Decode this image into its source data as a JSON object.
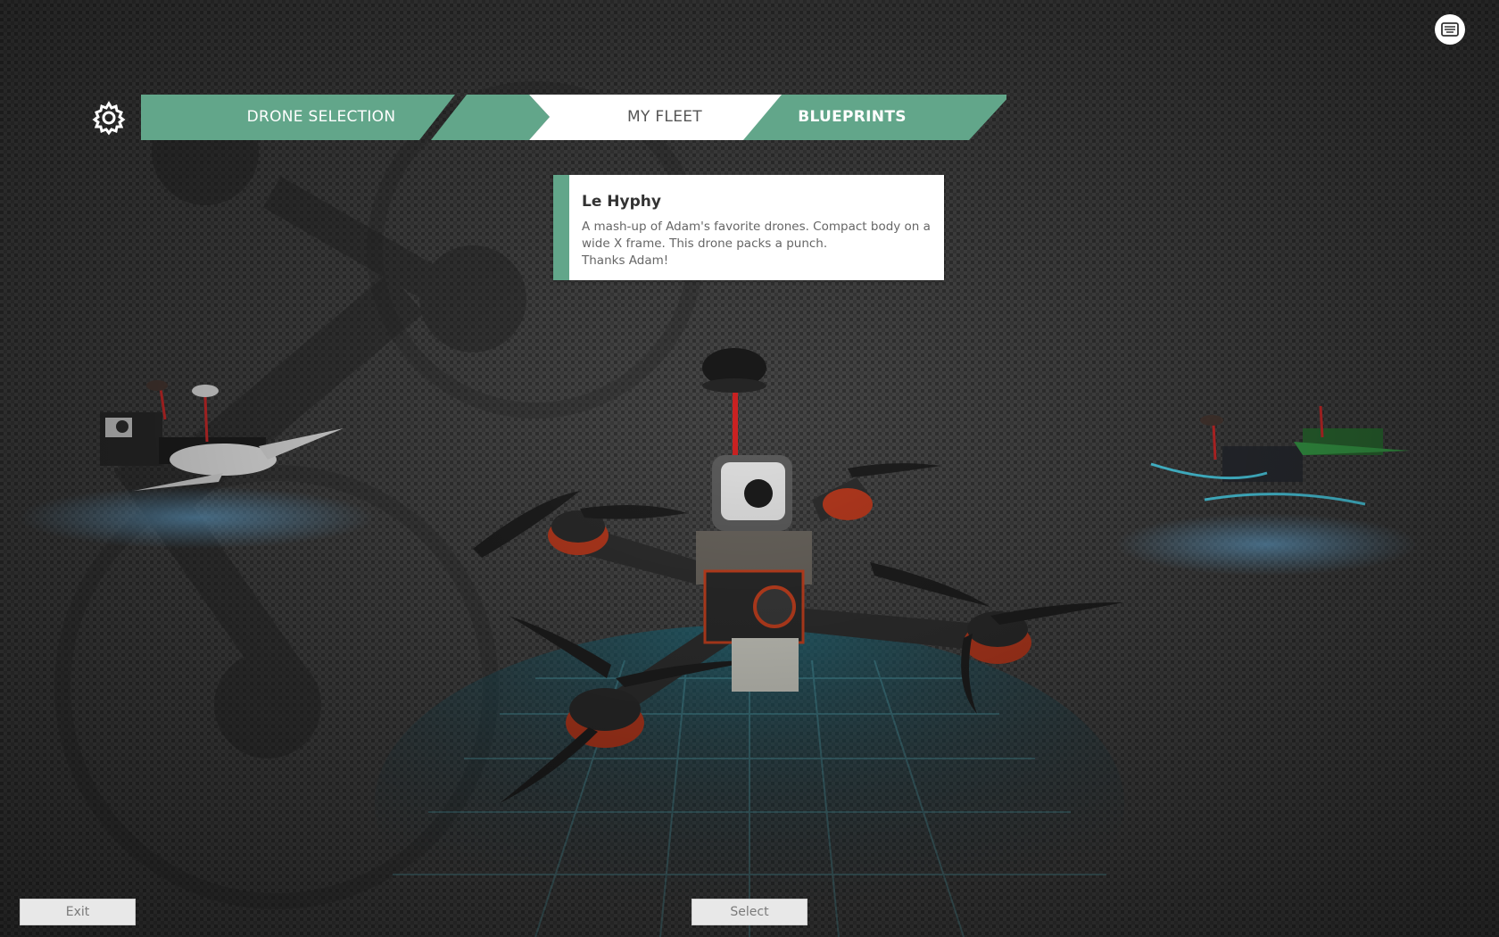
{
  "colors": {
    "accent": "#62a68a",
    "card_bg": "#ffffff",
    "button_bg": "#e8e8e8"
  },
  "nav": {
    "settings_icon": "gear-icon",
    "tabs": [
      {
        "label": "DRONE SELECTION"
      },
      {
        "label": "MY FLEET"
      },
      {
        "label": "BLUEPRINTS"
      }
    ]
  },
  "drone": {
    "name": "Le Hyphy",
    "description": "A mash-up of Adam's favorite drones. Compact body on a wide X frame. This drone packs a punch.\nThanks Adam!"
  },
  "footer": {
    "exit_label": "Exit",
    "select_label": "Select"
  },
  "top_right_icon": "keyboard-icon"
}
